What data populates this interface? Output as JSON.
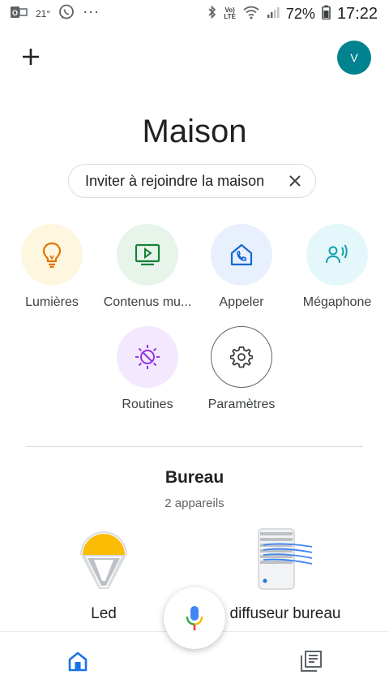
{
  "status_bar": {
    "temperature": "21°",
    "more": "···",
    "lte": "LTE",
    "volte": "Vo)",
    "battery": "72%",
    "time": "17:22"
  },
  "header": {
    "avatar_letter": "V",
    "title": "Maison"
  },
  "invite_chip": {
    "label": "Inviter à rejoindre la maison"
  },
  "actions": [
    {
      "label": "Lumières",
      "icon": "lightbulb-icon",
      "bg": "#fef7e0",
      "color": "#e37400"
    },
    {
      "label": "Contenus mu...",
      "icon": "media-play-icon",
      "bg": "#e6f4ea",
      "color": "#188038"
    },
    {
      "label": "Appeler",
      "icon": "home-call-icon",
      "bg": "#e8f0fe",
      "color": "#1967d2"
    },
    {
      "label": "Mégaphone",
      "icon": "megaphone-icon",
      "bg": "#e4f7fb",
      "color": "#129eaf"
    },
    {
      "label": "Routines",
      "icon": "routines-icon",
      "bg": "#f3e8fd",
      "color": "#9334e6"
    },
    {
      "label": "Paramètres",
      "icon": "settings-icon",
      "bg": "#ffffff",
      "color": "#3c4043"
    }
  ],
  "room": {
    "name": "Bureau",
    "device_count": "2 appareils",
    "devices": [
      {
        "name": "Led",
        "icon": "light-bulb-device-icon"
      },
      {
        "name": "diffuseur bureau",
        "icon": "speaker-device-icon"
      }
    ]
  },
  "colors": {
    "accent": "#1a73e8",
    "avatar": "#00838f",
    "mic_blue": "#4285f4",
    "mic_red": "#ea4335",
    "mic_yellow": "#fbbc04",
    "mic_green": "#34a853"
  },
  "bottom_nav": {
    "items": [
      "home-icon",
      "feed-icon"
    ]
  }
}
